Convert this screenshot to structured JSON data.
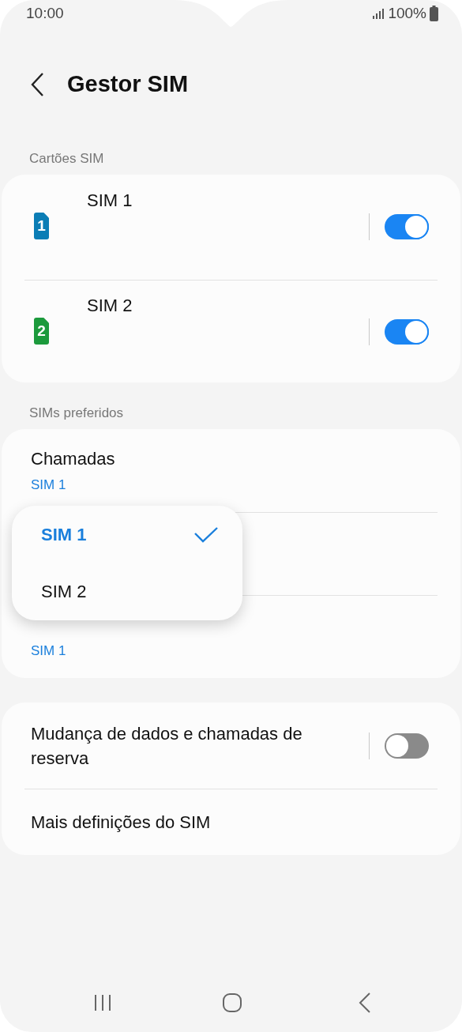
{
  "status_bar": {
    "time": "10:00",
    "battery": "100%"
  },
  "header": {
    "title": "Gestor SIM"
  },
  "sim_cards": {
    "label": "Cartões SIM",
    "items": [
      {
        "name": "SIM 1",
        "number": "1",
        "color": "#0b7db5",
        "on": true
      },
      {
        "name": "SIM 2",
        "number": "2",
        "color": "#1c9a3c",
        "on": true
      }
    ]
  },
  "preferred": {
    "label": "SIMs preferidos",
    "items": [
      {
        "kind": "option",
        "title": "Chamadas",
        "value": "SIM 1"
      },
      {
        "kind": "covered"
      },
      {
        "kind": "option",
        "value": "SIM 1"
      }
    ]
  },
  "popup": {
    "options": [
      {
        "label": "SIM 1",
        "selected": true
      },
      {
        "label": "SIM 2",
        "selected": false
      }
    ]
  },
  "more": {
    "items": [
      {
        "kind": "toggle",
        "title": "Mudança de dados e chamadas de reserva",
        "on": false
      },
      {
        "kind": "link",
        "title": "Mais definições do SIM"
      }
    ]
  }
}
